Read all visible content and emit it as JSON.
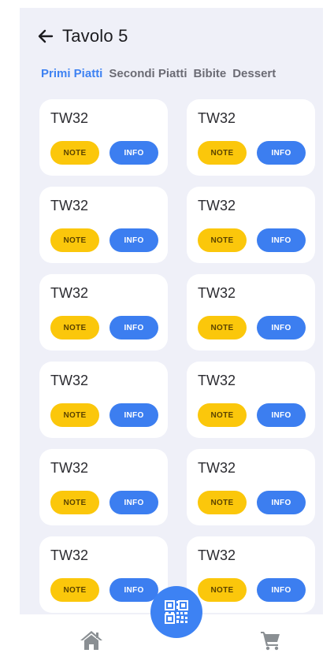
{
  "header": {
    "title": "Tavolo 5",
    "back_icon": "arrow-left-icon"
  },
  "tabs": [
    {
      "label": "Primi Piatti",
      "active": true
    },
    {
      "label": "Secondi Piatti",
      "active": false
    },
    {
      "label": "Bibite",
      "active": false
    },
    {
      "label": "Dessert",
      "active": false
    }
  ],
  "items": [
    {
      "name": "TW32",
      "note_label": "NOTE",
      "info_label": "INFO"
    },
    {
      "name": "TW32",
      "note_label": "NOTE",
      "info_label": "INFO"
    },
    {
      "name": "TW32",
      "note_label": "NOTE",
      "info_label": "INFO"
    },
    {
      "name": "TW32",
      "note_label": "NOTE",
      "info_label": "INFO"
    },
    {
      "name": "TW32",
      "note_label": "NOTE",
      "info_label": "INFO"
    },
    {
      "name": "TW32",
      "note_label": "NOTE",
      "info_label": "INFO"
    },
    {
      "name": "TW32",
      "note_label": "NOTE",
      "info_label": "INFO"
    },
    {
      "name": "TW32",
      "note_label": "NOTE",
      "info_label": "INFO"
    },
    {
      "name": "TW32",
      "note_label": "NOTE",
      "info_label": "INFO"
    },
    {
      "name": "TW32",
      "note_label": "NOTE",
      "info_label": "INFO"
    },
    {
      "name": "TW32",
      "note_label": "NOTE",
      "info_label": "INFO"
    },
    {
      "name": "TW32",
      "note_label": "NOTE",
      "info_label": "INFO"
    }
  ],
  "bottom_nav": {
    "left_icon": "home-icon",
    "center_icon": "qr-code-icon",
    "right_icon": "cart-icon"
  },
  "colors": {
    "accent": "#3e82f2",
    "note": "#fbc70b",
    "info": "#3c7ef0",
    "background": "#eff0f8",
    "nav_icon": "#8a8f93"
  }
}
